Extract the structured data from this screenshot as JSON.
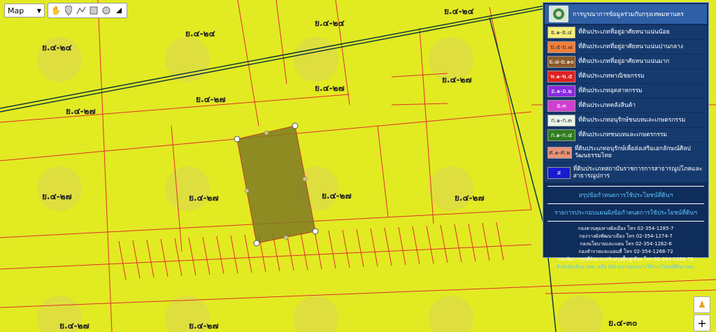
{
  "map": {
    "layer_select": "Map",
    "tools": [
      "hand-icon",
      "pin-icon",
      "polyline-icon",
      "square-icon",
      "circle-icon",
      "eraser-icon"
    ],
    "zone_labels": [
      "ย.๔-๒๔",
      "ย.๔-๒๔",
      "ย.๔-๒๔",
      "ย.๔-๒๔",
      "ย.๔-๒๗",
      "ย.๔-๒๗",
      "ย.๔-๒๗",
      "ย.๔-๒๗",
      "ย.๔-๒๗",
      "ย.๔-๒๗",
      "ย.๔-๒๗",
      "ย.๔-๒๗",
      "ย.๔-๒๗",
      "ย.๔-๒๗",
      "ย.๔-๓๐"
    ],
    "colors": {
      "zone_fill": "#e2ea22",
      "lot_line": "#e0302c",
      "road_line": "#0d3b3b",
      "selection": "#7f7a22"
    }
  },
  "legend": {
    "title": "การบูรณาการข้อมูลร่วมกับกรุงเทพมหานคร",
    "items": [
      {
        "code": "ย.๑-ย.๔",
        "label": "ที่ดินประเภทที่อยู่อาศัยหนาแน่นน้อย",
        "color": "#f5f07a",
        "text_color": "#333"
      },
      {
        "code": "ย.๕-ย.๗",
        "label": "ที่ดินประเภทที่อยู่อาศัยหนาแน่นปานกลาง",
        "color": "#f07f3c",
        "text_color": "#333"
      },
      {
        "code": "ย.๘-ย.๑๐",
        "label": "ที่ดินประเภทที่อยู่อาศัยหนาแน่นมาก",
        "color": "#8a5a2a",
        "text_color": "#fff"
      },
      {
        "code": "พ.๑-พ.๕",
        "label": "ที่ดินประเภทพาณิชยกรรม",
        "color": "#e02020",
        "text_color": "#fff"
      },
      {
        "code": "อ.๑-อ.๒",
        "label": "ที่ดินประเภทอุตสาหกรรม",
        "color": "#8a2be2",
        "text_color": "#fff"
      },
      {
        "code": "อ.๓",
        "label": "ที่ดินประเภทคลังสินค้า",
        "color": "#d040d0",
        "text_color": "#fff"
      },
      {
        "code": "ก.๑-ก.๓",
        "label": "ที่ดินประเภทอนุรักษ์ชนบทและเกษตรกรรม",
        "color": "#eaf6ea",
        "text_color": "#333"
      },
      {
        "code": "ก.๑-ก.๔",
        "label": "ที่ดินประเภทชนบทและเกษตรกรรม",
        "color": "#2e7d1e",
        "text_color": "#fff"
      },
      {
        "code": "ศ.๑-ศ.๒",
        "label": "ที่ดินประเภทอนุรักษ์เพื่อส่งเสริมเอกลักษณ์ศิลปวัฒนธรรมไทย",
        "color": "#e8927a",
        "text_color": "#333"
      },
      {
        "code": "ส",
        "label": "ที่ดินประเภทสถาบันราชการการสาธารณูปโภคและสาธารณูปการ",
        "color": "#1a1ad0",
        "text_color": "#fff"
      }
    ],
    "links": [
      "สรุปข้อกำหนดการใช้ประโยชน์ที่ดินฯ",
      "รายการประกอบแผนผังข้อกำหนดการใช้ประโยชน์ที่ดินฯ"
    ],
    "contacts": [
      "กองควบคุมทางผังเมือง โทร 02-354-1285-7",
      "กองวางผังพัฒนาเมือง โทร 02-354-1274-7",
      "กองนโยบายและแผน โทร 02-354-1262-6",
      "กองสำรวจและแผนที่ โทร 02-354-1268-72",
      "กองจัดการรูปที่ดินและปรับปรุงพื้นฟูเมือง โทร 02-354-1268-72"
    ],
    "footer": "สำนักผังเมือง กทม. หรือ GIS ตรวจสอบการใช้ประโยชน์ที่ดิน กทม."
  },
  "controls": {
    "zoom_in": "+"
  }
}
